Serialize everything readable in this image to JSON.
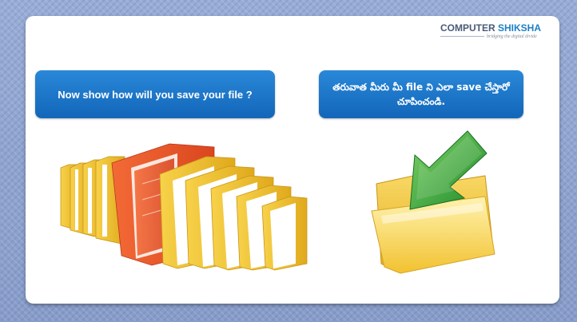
{
  "brand": {
    "name_part1": "COMPUTER ",
    "name_part2": "SHIKSHA",
    "tagline": "bridging the digital divide"
  },
  "bubbles": {
    "english": "Now show how will you save your file ?",
    "telugu": "తరువాత మీరు మీ file ని ఎలా save చేస్తారో చూపించండి."
  },
  "icons": {
    "folders": "folders-icon",
    "save": "save-folder-icon"
  },
  "colors": {
    "bubble": "#1976c9",
    "background": "#8ea2cf",
    "folder_yellow": "#f2c230",
    "folder_orange": "#ec5a2a",
    "arrow_green": "#2fa13a"
  }
}
